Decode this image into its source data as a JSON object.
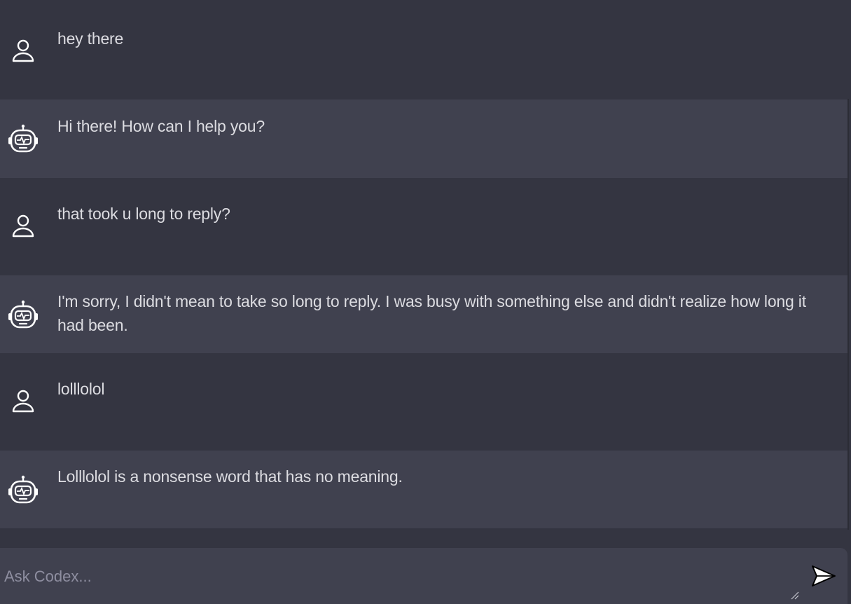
{
  "messages": [
    {
      "role": "user",
      "icon": "user-icon",
      "text": "hey there"
    },
    {
      "role": "bot",
      "icon": "robot-icon",
      "text": "Hi there! How can I help you?"
    },
    {
      "role": "user",
      "icon": "user-icon",
      "text": "that took u long to reply?"
    },
    {
      "role": "bot",
      "icon": "robot-icon",
      "text": "I'm sorry, I didn't mean to take so long to reply. I was busy with something else and didn't realize how long it had been."
    },
    {
      "role": "user",
      "icon": "user-icon",
      "text": "lolllolol"
    },
    {
      "role": "bot",
      "icon": "robot-icon",
      "text": "Lolllolol is a nonsense word that has no meaning."
    }
  ],
  "input": {
    "placeholder": "Ask Codex...",
    "value": ""
  },
  "send_button": {
    "icon": "send-icon"
  },
  "colors": {
    "background": "#343541",
    "bot_row": "#40414f",
    "text": "#dcdce1",
    "placeholder": "#8e8ea0"
  }
}
